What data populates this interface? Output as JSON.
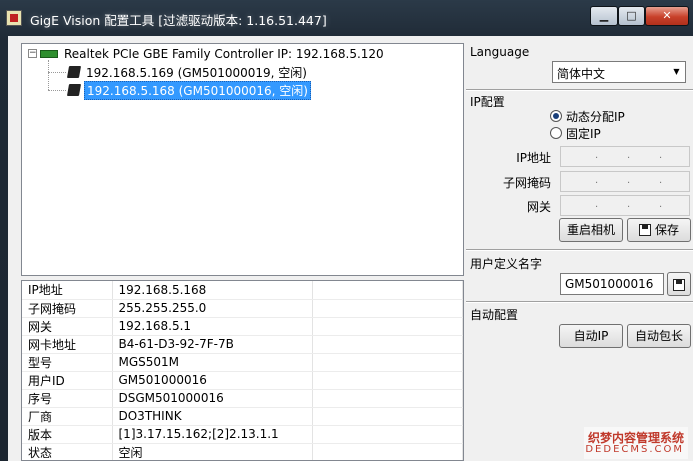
{
  "window": {
    "title": "GigE Vision 配置工具 [过滤驱动版本: 1.16.51.447]",
    "min_label": "▁",
    "max_label": "□",
    "close_label": "✕"
  },
  "tree": {
    "expander": "−",
    "root_label": "Realtek PCIe GBE Family Controller  IP: 192.168.5.120",
    "root_icon": "network-card-icon",
    "children": [
      {
        "label": "192.168.5.169  (GM501000019, 空闲)",
        "icon": "camera-icon",
        "selected": false
      },
      {
        "label": "192.168.5.168  (GM501000016, 空闲)",
        "icon": "camera-icon",
        "selected": true
      }
    ]
  },
  "properties": [
    {
      "key": "IP地址",
      "value": "192.168.5.168"
    },
    {
      "key": "子网掩码",
      "value": "255.255.255.0"
    },
    {
      "key": "网关",
      "value": "192.168.5.1"
    },
    {
      "key": "网卡地址",
      "value": "B4-61-D3-92-7F-7B"
    },
    {
      "key": "型号",
      "value": "MGS501M"
    },
    {
      "key": "用户ID",
      "value": "GM501000016"
    },
    {
      "key": "序号",
      "value": "DSGM501000016"
    },
    {
      "key": "厂商",
      "value": "DO3THINK"
    },
    {
      "key": "版本",
      "value": "[1]3.17.15.162;[2]2.13.1.1"
    },
    {
      "key": "状态",
      "value": "空闲"
    }
  ],
  "language": {
    "title": "Language",
    "selected": "简体中文",
    "arrow": "▼"
  },
  "ip_config": {
    "title": "IP配置",
    "option_dhcp": "动态分配IP",
    "option_static": "固定IP",
    "selected": "dhcp",
    "ip_label": "IP地址",
    "mask_label": "子网掩码",
    "gateway_label": "网关",
    "dots": ".",
    "restart_label": "重启相机",
    "save_label": "保存"
  },
  "user_name": {
    "title": "用户定义名字",
    "value": "GM501000016"
  },
  "auto_config": {
    "title": "自动配置",
    "auto_ip_label": "自动IP",
    "auto_packet_label": "自动包长"
  },
  "watermark": {
    "line1": "织梦内容管理系统",
    "line2": "DEDECMS.COM"
  },
  "colors": {
    "selection": "#3399ff",
    "titlebar": "#2b3a48",
    "close": "#c8402a"
  }
}
